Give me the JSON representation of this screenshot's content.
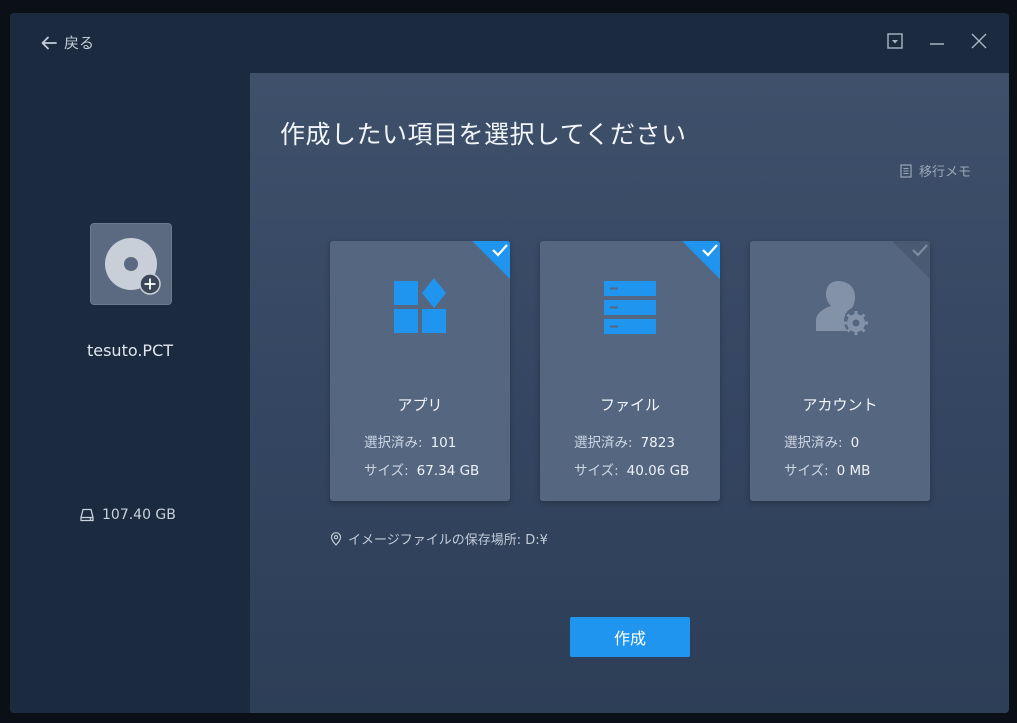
{
  "titlebar": {
    "back_label": "戻る"
  },
  "sidebar": {
    "drive_name": "tesuto.PCT",
    "drive_size": "107.40 GB"
  },
  "main": {
    "title": "作成したい項目を選択してください",
    "memo_label": "移行メモ",
    "location_label": "イメージファイルの保存場所: D:¥",
    "create_label": "作成"
  },
  "cards": [
    {
      "name": "アプリ",
      "selected_label": "選択済み:",
      "selected_value": "101",
      "size_label": "サイズ:",
      "size_value": "67.34 GB",
      "checked": true,
      "icon": "apps-icon"
    },
    {
      "name": "ファイル",
      "selected_label": "選択済み:",
      "selected_value": "7823",
      "size_label": "サイズ:",
      "size_value": "40.06 GB",
      "checked": true,
      "icon": "files-icon"
    },
    {
      "name": "アカウント",
      "selected_label": "選択済み:",
      "selected_value": "0",
      "size_label": "サイズ:",
      "size_value": "0 MB",
      "checked": false,
      "icon": "account-settings-icon"
    }
  ],
  "colors": {
    "accent": "#1f95f0",
    "sidebar_bg": "#1b2a3e",
    "card_bg": "#556680"
  }
}
